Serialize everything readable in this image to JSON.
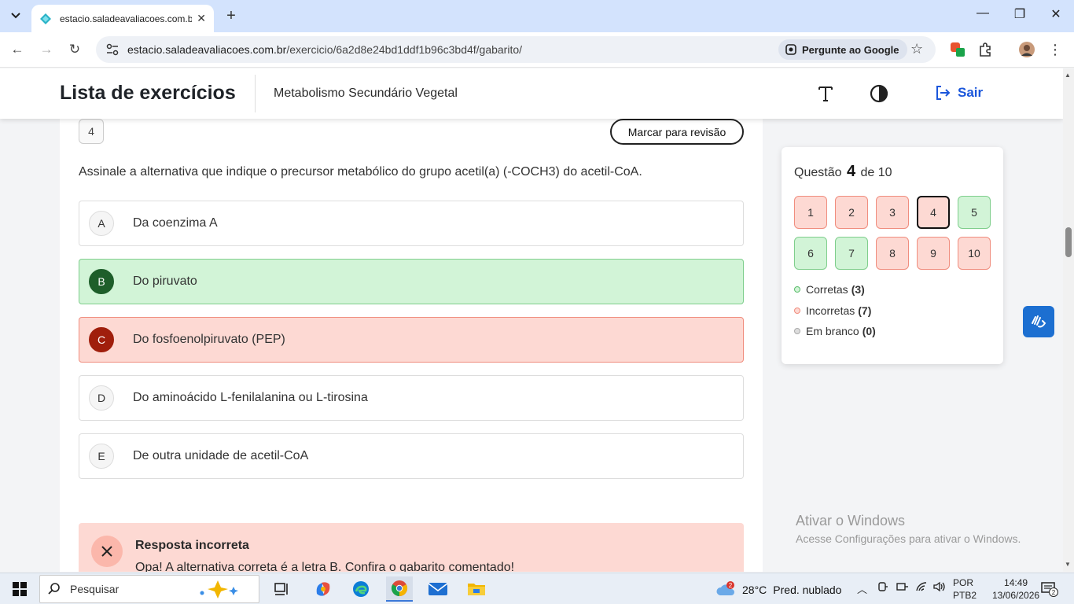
{
  "browser": {
    "tab_title": "estacio.saladeavaliacoes.com.br",
    "url_host": "estacio.saladeavaliacoes.com.br",
    "url_path": "/exercicio/6a2d8e24bd1ddf1b96c3bd4f/gabarito/",
    "ask_google": "Pergunte ao Google"
  },
  "header": {
    "title": "Lista de exercícios",
    "subject": "Metabolismo Secundário Vegetal",
    "logout_label": "Sair"
  },
  "question": {
    "number": "4",
    "review_label": "Marcar para revisão",
    "stem": "Assinale a alternativa que indique o precursor metabólico do grupo acetil(a) (-COCH3) do acetil-CoA.",
    "alternatives": [
      {
        "letter": "A",
        "text": "Da coenzima A",
        "state": "neutral"
      },
      {
        "letter": "B",
        "text": "Do piruvato",
        "state": "correct"
      },
      {
        "letter": "C",
        "text": "Do fosfoenolpiruvato (PEP)",
        "state": "wrong"
      },
      {
        "letter": "D",
        "text": "Do aminoácido L-fenilalanina ou L-tirosina",
        "state": "neutral"
      },
      {
        "letter": "E",
        "text": "De outra unidade de acetil-CoA",
        "state": "neutral"
      }
    ],
    "feedback_title": "Resposta incorreta",
    "feedback_text": "Opa! A alternativa correta é a letra B. Confira o gabarito comentado!"
  },
  "panel": {
    "prefix": "Questão",
    "current": "4",
    "suffix": "de 10",
    "questions": [
      {
        "n": "1",
        "state": "wrong"
      },
      {
        "n": "2",
        "state": "wrong"
      },
      {
        "n": "3",
        "state": "wrong"
      },
      {
        "n": "4",
        "state": "wrong",
        "current": true
      },
      {
        "n": "5",
        "state": "right"
      },
      {
        "n": "6",
        "state": "right"
      },
      {
        "n": "7",
        "state": "right"
      },
      {
        "n": "8",
        "state": "wrong"
      },
      {
        "n": "9",
        "state": "wrong"
      },
      {
        "n": "10",
        "state": "wrong"
      }
    ],
    "legend": {
      "correct_label": "Corretas",
      "correct_count": "(3)",
      "incorrect_label": "Incorretas",
      "incorrect_count": "(7)",
      "blank_label": "Em branco",
      "blank_count": "(0)"
    }
  },
  "watermark": {
    "line1": "Ativar o Windows",
    "line2": "Acesse Configurações para ativar o Windows."
  },
  "taskbar": {
    "search_placeholder": "Pesquisar",
    "temperature": "28°C",
    "weather": "Pred. nublado",
    "weather_badge": "2",
    "lang1": "POR",
    "lang2": "PTB2",
    "time": "14:49",
    "date": "13/06/2026",
    "notif_count": "2"
  },
  "colors": {
    "correct_bg": "#d2f4d7",
    "wrong_bg": "#fdd9d3",
    "accent": "#1a56db"
  }
}
